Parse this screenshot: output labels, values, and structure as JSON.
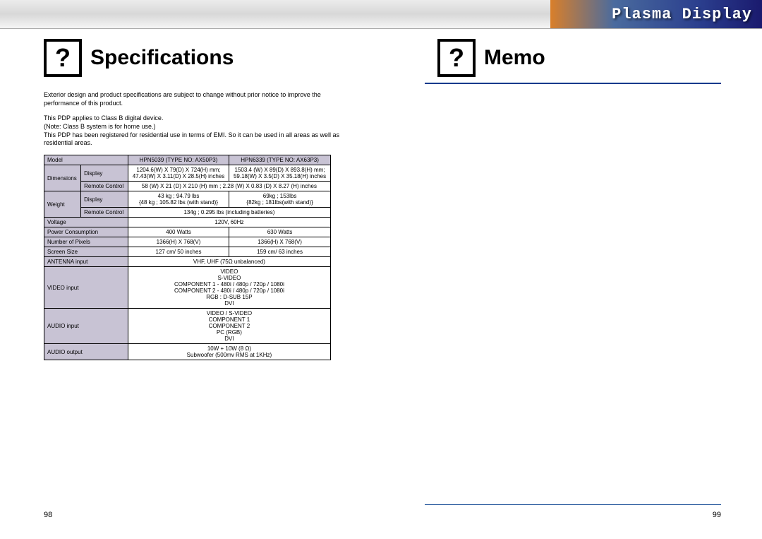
{
  "banner": "Plasma Display",
  "left": {
    "title": "Specifications",
    "intro1": "Exterior design and product specifications are subject to change without prior notice to improve the performance of this product.",
    "intro2": "This PDP applies to Class B digital device.\n(Note: Class B system is for home use.)\nThis PDP has been registered for residential use in terms of EMI. So it can be used in all areas as well as residential areas.",
    "pageNum": "98"
  },
  "right": {
    "title": "Memo",
    "pageNum": "99"
  },
  "chart_data": {
    "type": "table",
    "header": [
      "Model",
      "HPN5039 (TYPE NO: AX50P3)",
      "HPN6339 (TYPE NO: AX63P3)"
    ],
    "rows": [
      {
        "group": "Dimensions",
        "sub": "Display",
        "col1": "1204.6(W) X 79(D) X 724(H) mm;\n47.43(W) X 3.11(D) X 28.5(H) inches",
        "col2": "1503.4 (W) X 89(D) X 893.8(H) mm;\n59.18(W) X 3.5(D) X 35.18(H) inches"
      },
      {
        "group": "",
        "sub": "Remote Control",
        "col1": "58 (W) X 21 (D) X 210 (H) mm ; 2.28 (W) X 0.83 (D) X 8.27 (H) inches",
        "col2": "merged"
      },
      {
        "group": "Weight",
        "sub": "Display",
        "col1": "43 kg ; 94.79 lbs\n{48 kg ; 105.82 lbs (with stand)}",
        "col2": "69kg ; 153lbs\n{82kg ; 181lbs(with stand)}"
      },
      {
        "group": "",
        "sub": "Remote Control",
        "col1": "134g ; 0.295 lbs (including batteries)",
        "col2": "merged"
      },
      {
        "group": "Voltage",
        "sub": "",
        "col1": "120V, 60Hz",
        "col2": "merged"
      },
      {
        "group": "Power Consumption",
        "sub": "",
        "col1": "400 Watts",
        "col2": "630 Watts"
      },
      {
        "group": "Number of Pixels",
        "sub": "",
        "col1": "1366(H) X 768(V)",
        "col2": "1366(H) X 768(V)"
      },
      {
        "group": "Screen Size",
        "sub": "",
        "col1": "127 cm/ 50 inches",
        "col2": "159 cm/ 63 inches"
      },
      {
        "group": "ANTENNA input",
        "sub": "",
        "col1": "VHF, UHF (75Ω unbalanced)",
        "col2": "merged"
      },
      {
        "group": "VIDEO input",
        "sub": "",
        "col1": "VIDEO\nS-VIDEO\nCOMPONENT 1 - 480i / 480p / 720p / 1080i\nCOMPONENT 2 - 480i / 480p / 720p / 1080i\nRGB : D-SUB 15P\nDVI",
        "col2": "merged"
      },
      {
        "group": "AUDIO input",
        "sub": "",
        "col1": "VIDEO / S-VIDEO\nCOMPONENT 1\nCOMPONENT 2\nPC (RGB)\nDVI",
        "col2": "merged"
      },
      {
        "group": "AUDIO output",
        "sub": "",
        "col1": "10W + 10W (8 Ω)\nSubwoofer (500mv RMS at 1KHz)",
        "col2": "merged"
      }
    ]
  }
}
